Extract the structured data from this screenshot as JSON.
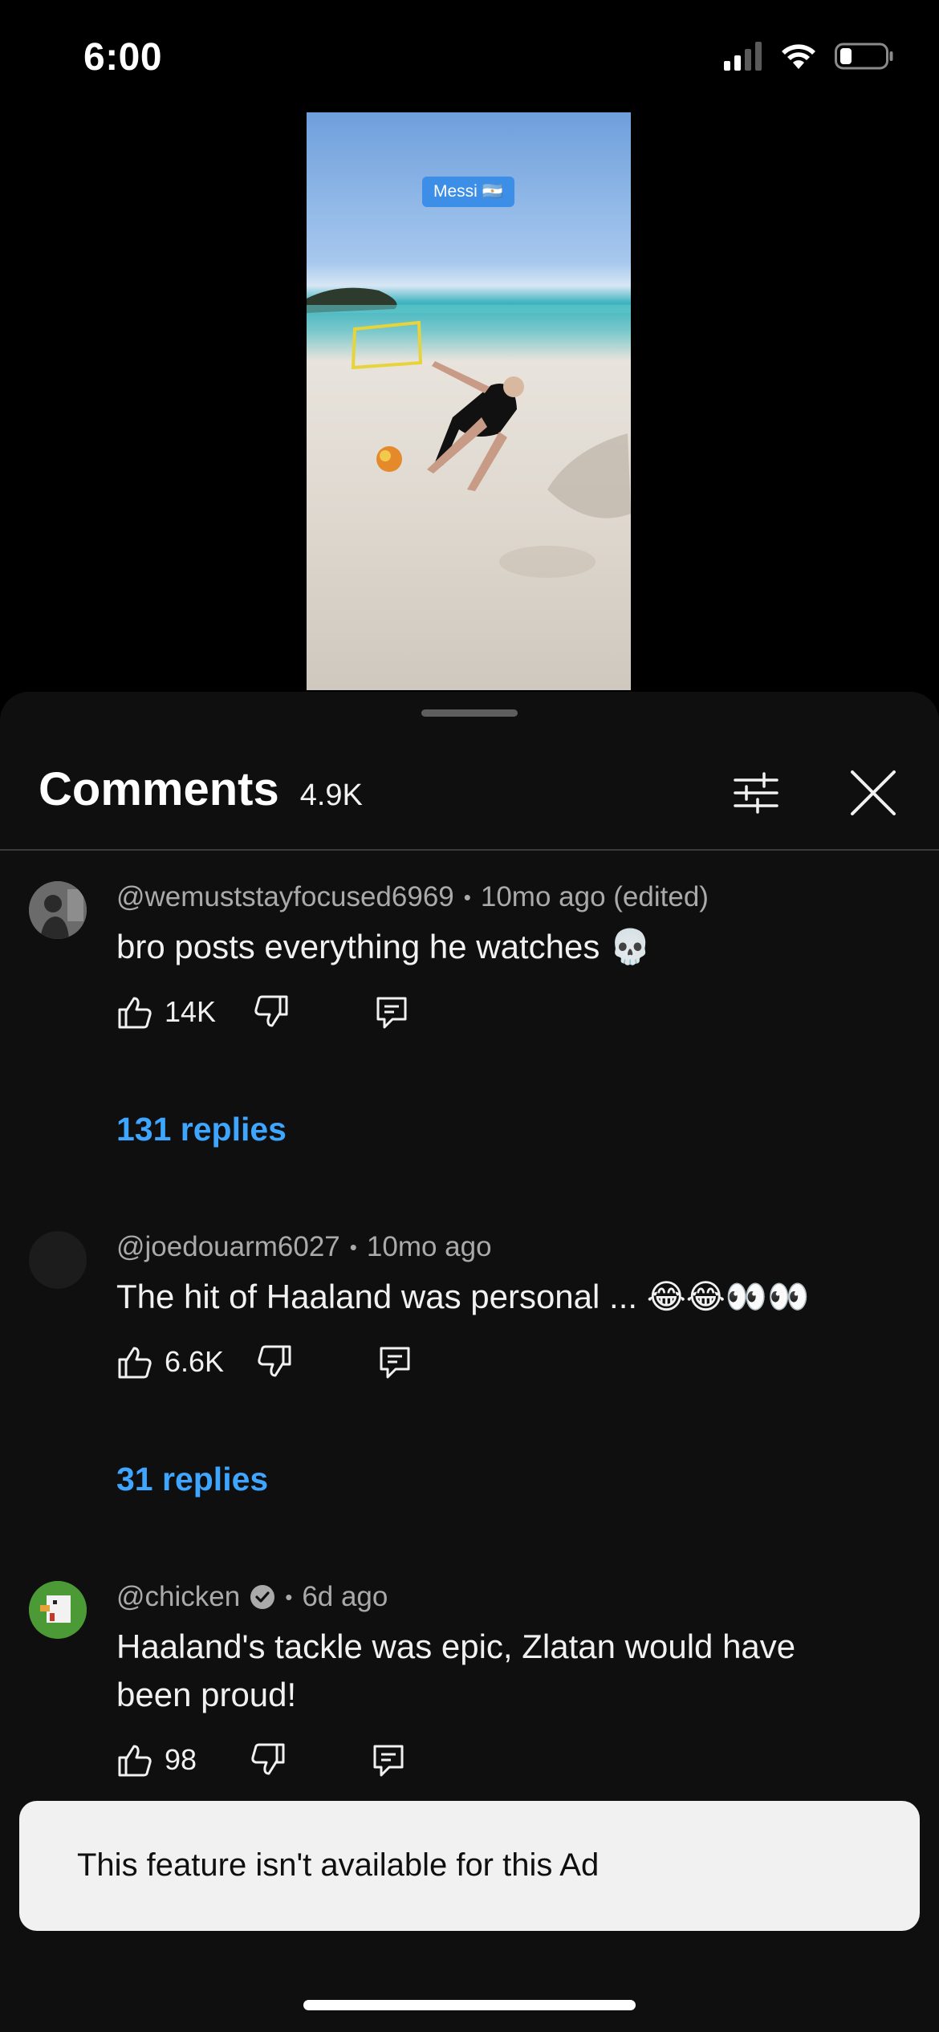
{
  "status_bar": {
    "time": "6:00",
    "icons": [
      "cellular-signal-icon",
      "wifi-icon",
      "battery-icon"
    ]
  },
  "video": {
    "tag_label": "Messi 🇦🇷"
  },
  "comments_panel": {
    "title": "Comments",
    "count": "4.9K",
    "filter_icon": "sliders-icon",
    "close_icon": "close-icon",
    "comments": [
      {
        "author": "@wemuststayfocused6969",
        "separator": "•",
        "time": "10mo ago (edited)",
        "text": "bro posts everything he watches 💀",
        "likes": "14K",
        "replies": "131 replies"
      },
      {
        "author": "@joedouarm6027",
        "separator": "•",
        "time": "10mo ago",
        "text": "The hit of Haaland was personal ... 😂😂👀👀",
        "likes": "6.6K",
        "replies": "31 replies"
      },
      {
        "author": "@chicken",
        "separator": "•",
        "time": "6d ago",
        "text": "Haaland's tackle was epic, Zlatan would have been proud!",
        "likes": "98"
      }
    ]
  },
  "toast": {
    "message": "This feature isn't available for this Ad"
  },
  "colors": {
    "background": "#0f0f0f",
    "accent_link": "#3ea6ff",
    "toast_bg": "#f1f1f1",
    "secondary_text": "#aaaaaa"
  }
}
